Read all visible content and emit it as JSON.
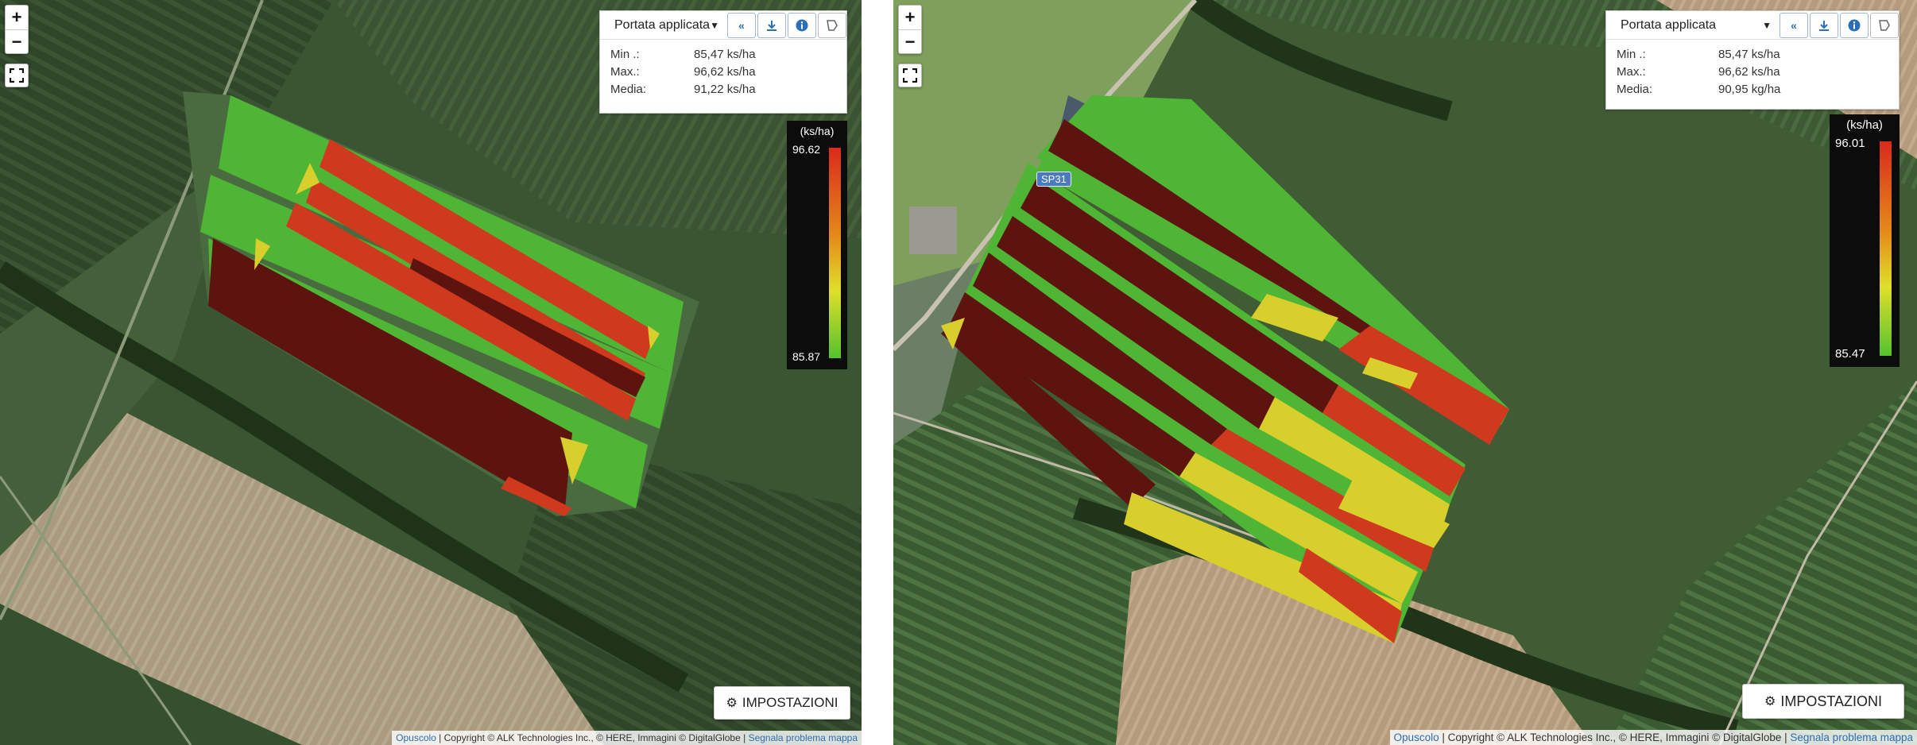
{
  "maps": [
    {
      "id": "left",
      "zoom": {
        "in_label": "+",
        "out_label": "−"
      },
      "info": {
        "layer": "Portata applicata",
        "stats": [
          {
            "label": "Min .:",
            "value": "85,47 ks/ha"
          },
          {
            "label": "Max.:",
            "value": "96,62 ks/ha"
          },
          {
            "label": "Media:",
            "value": "91,22 ks/ha"
          }
        ]
      },
      "legend": {
        "unit": "(ks/ha)",
        "max": "96.62",
        "min": "85.87"
      },
      "settings_label": "IMPOSTAZIONI",
      "attribution": {
        "link1": "Opuscolo",
        "text": " | Copyright © ALK Technologies Inc., © HERE, Immagini © DigitalGlobe | ",
        "link2": "Segnala problema mappa"
      }
    },
    {
      "id": "right",
      "zoom": {
        "in_label": "+",
        "out_label": "−"
      },
      "info": {
        "layer": "Portata applicata",
        "stats": [
          {
            "label": "Min .:",
            "value": "85,47 ks/ha"
          },
          {
            "label": "Max.:",
            "value": "96,62 ks/ha"
          },
          {
            "label": "Media:",
            "value": "90,95 kg/ha"
          }
        ]
      },
      "legend": {
        "unit": "(ks/ha)",
        "max": "96.01",
        "min": "85.47"
      },
      "settings_label": "IMPOSTAZIONI",
      "road_label": "SP31",
      "attribution": {
        "link1": "Opuscolo",
        "text": " | Copyright © ALK Technologies Inc., © HERE, Immagini © DigitalGlobe | ",
        "link2": "Segnala problema mappa"
      }
    }
  ],
  "colors": {
    "green": "#4fb534",
    "yellow": "#d8cf2c",
    "orange_red": "#cf3a1f",
    "dark_red": "#5e140e",
    "field_dark": "#324a2c",
    "field_light": "#5f7a49"
  },
  "icons": [
    "zoom-in-icon",
    "zoom-out-icon",
    "fullscreen-icon",
    "chevron-up-double-icon",
    "download-icon",
    "info-icon",
    "polygon-icon",
    "gear-icon"
  ]
}
